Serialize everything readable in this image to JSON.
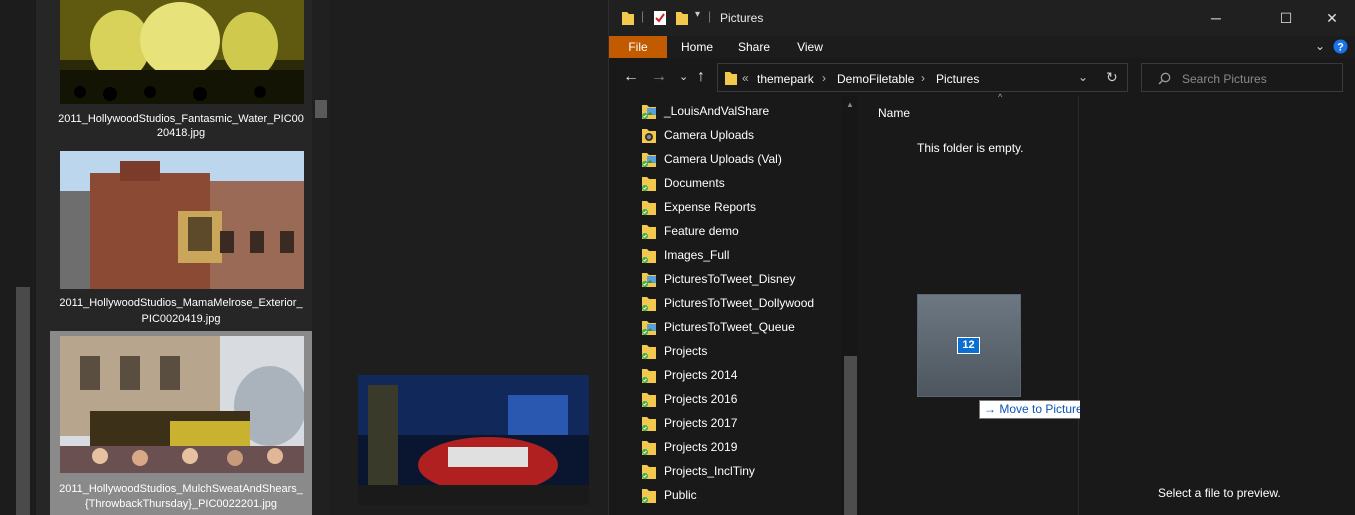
{
  "gallery": {
    "items": [
      {
        "caption_line1": "2011_HollywoodStudios_Fantasmic_Water_PIC00",
        "caption_line2": "20418.jpg"
      },
      {
        "caption_line1": "2011_HollywoodStudios_MamaMelrose_Exterior_",
        "caption_line2": "PIC0020419.jpg"
      },
      {
        "caption_line1": "2011_HollywoodStudios_MulchSweatAndShears_",
        "caption_line2": "{ThrowbackThursday}_PIC0022201.jpg"
      }
    ]
  },
  "explorer": {
    "title": "Pictures",
    "ribbon_tabs": [
      "File",
      "Home",
      "Share",
      "View"
    ],
    "breadcrumb": [
      "themepark",
      "DemoFiletable",
      "Pictures"
    ],
    "search_placeholder": "Search Pictures",
    "nav_items": [
      {
        "label": "_LouisAndValShare",
        "icon": "folder-image-icon"
      },
      {
        "label": "Camera Uploads",
        "icon": "camera-folder-icon"
      },
      {
        "label": "Camera Uploads (Val)",
        "icon": "folder-image-icon"
      },
      {
        "label": "Documents",
        "icon": "folder-synced-icon"
      },
      {
        "label": "Expense Reports",
        "icon": "folder-synced-icon"
      },
      {
        "label": "Feature demo",
        "icon": "folder-synced-icon"
      },
      {
        "label": "Images_Full",
        "icon": "folder-synced-icon"
      },
      {
        "label": "PicturesToTweet_Disney",
        "icon": "folder-image-icon"
      },
      {
        "label": "PicturesToTweet_Dollywood",
        "icon": "folder-synced-icon"
      },
      {
        "label": "PicturesToTweet_Queue",
        "icon": "folder-image-icon"
      },
      {
        "label": "Projects",
        "icon": "folder-synced-icon"
      },
      {
        "label": "Projects 2014",
        "icon": "folder-synced-icon"
      },
      {
        "label": "Projects 2016",
        "icon": "folder-synced-icon"
      },
      {
        "label": "Projects 2017",
        "icon": "folder-synced-icon"
      },
      {
        "label": "Projects 2019",
        "icon": "folder-synced-icon"
      },
      {
        "label": "Projects_InclTiny",
        "icon": "folder-synced-icon"
      },
      {
        "label": "Public",
        "icon": "folder-synced-icon"
      }
    ],
    "column_name": "Name",
    "empty_message": "This folder is empty.",
    "drag_count": "12",
    "drag_tooltip": "Move to Pictures",
    "preview_message": "Select a file to preview."
  },
  "colors": {
    "file_tab": "#c25a00",
    "drag_badge": "#0b6fd1",
    "folder": "#f2c94c",
    "sync_check": "#3fae3f"
  }
}
